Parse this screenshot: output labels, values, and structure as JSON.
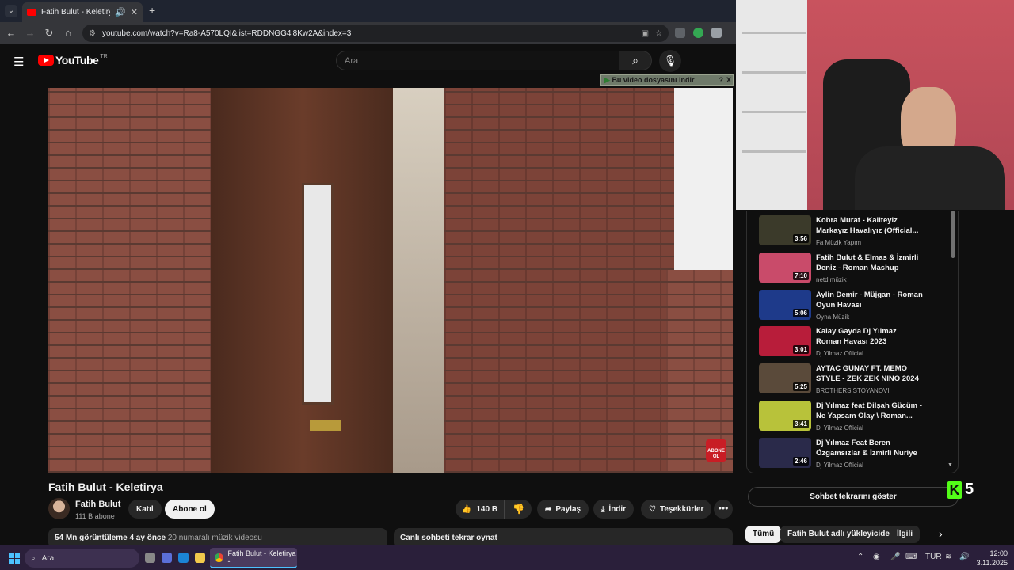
{
  "browser": {
    "tab_title": "Fatih Bulut - Keletirya - You",
    "url": "youtube.com/watch?v=Ra8-A570LQI&list=RDDNGG4l8Kw2A&index=3"
  },
  "youtube": {
    "logo": "YouTube",
    "country_code": "TR",
    "search_placeholder": "Ara"
  },
  "download_banner": "Bu video dosyasını indir",
  "download_banner_help": "?",
  "download_banner_close": "X",
  "video": {
    "title": "Fatih Bulut - Keletirya",
    "channel": "Fatih Bulut",
    "subscribers": "111 B abone",
    "join_label": "Katıl",
    "subscribe_label": "Abone ol",
    "likes": "140 B",
    "share_label": "Paylaş",
    "download_label": "İndir",
    "thanks_label": "Teşekkürler",
    "overlay_badge": "ABONE OL",
    "description": {
      "views": "54 Mn görüntüleme",
      "age": "4 ay önce",
      "tag": "20 numaralı müzik videosu"
    },
    "chat_replay": "Canlı sohbeti tekrar oynat"
  },
  "playlist": [
    {
      "title": "Kobra Murat - Kaliteyiz Markayız Havalıyız (Official...",
      "channel": "Fa Müzik Yapım",
      "duration": "3:56",
      "color": "#3b3a2a"
    },
    {
      "title": "Fatih Bulut & Elmas & İzmirli Deniz - Roman Mashup",
      "channel": "netd müzik",
      "duration": "7:10",
      "color": "#c94b6a"
    },
    {
      "title": "Aylin Demir - Müjgan - Roman Oyun Havası",
      "channel": "Oyna Müzik",
      "duration": "5:06",
      "color": "#1e3a8a"
    },
    {
      "title": "Kalay Gayda Dj Yılmaz Roman Havası 2023 #djyilmaz...",
      "channel": "Dj Yilmaz Official",
      "duration": "3:01",
      "color": "#b81d3a"
    },
    {
      "title": "AYTAC GUNAY FT. MEMO STYLE - ZEK ZEK NINO 2024 ...",
      "channel": "BROTHERS STOYANOVI",
      "duration": "5:25",
      "color": "#5a4a3a"
    },
    {
      "title": "Dj Yılmaz feat Dilşah Gücüm - Ne Yapsam Olay \\ Roman...",
      "channel": "Dj Yilmaz Official",
      "duration": "3:41",
      "color": "#b8c23a"
    },
    {
      "title": "Dj Yılmaz Feat Beren Özgamsızlar & İzmirli Nuriye -...",
      "channel": "Dj Yilmaz Official",
      "duration": "2:46",
      "color": "#2a2a4a"
    }
  ],
  "chat_button": "Sohbet tekrarını göster",
  "kick_badge": {
    "letter": "K",
    "number": "5"
  },
  "chips": [
    "Tümü",
    "Fatih Bulut adlı yükleyiciden",
    "İlgili"
  ],
  "taskbar": {
    "search_placeholder": "Ara",
    "chrome_label": "Fatih Bulut - Keletirya -",
    "language": "TUR",
    "time": "12:00",
    "date": "3.11.2025"
  }
}
